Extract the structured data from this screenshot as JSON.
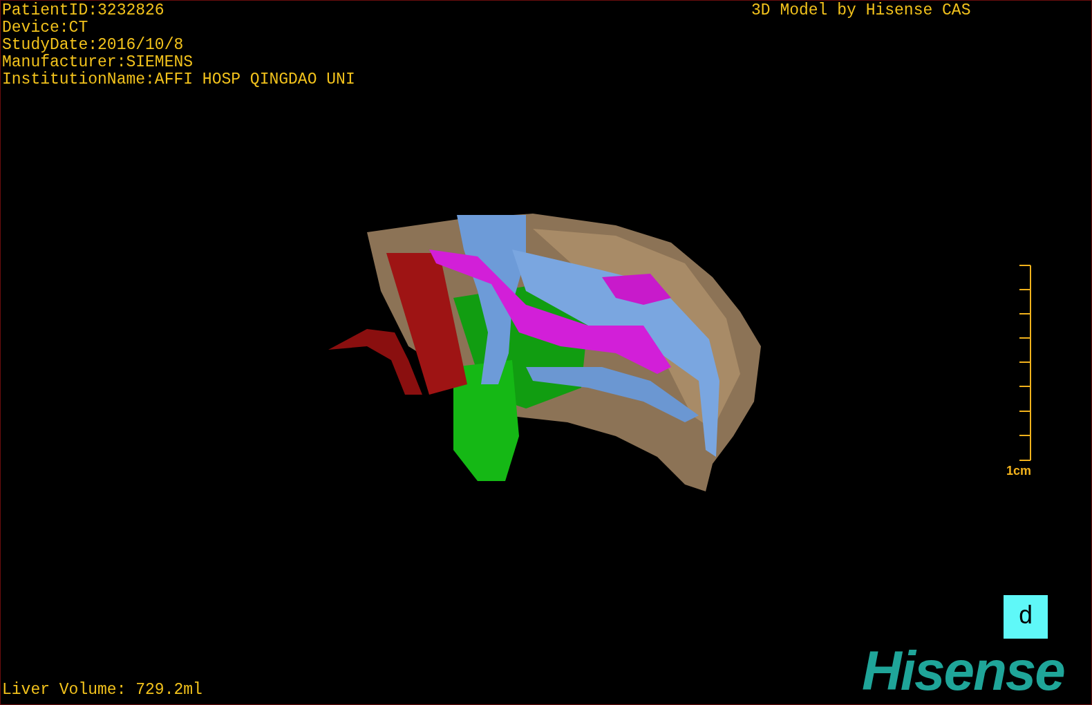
{
  "info_lines": [
    "PatientID:3232826",
    "Device:CT",
    "StudyDate:2016/10/8",
    "Manufacturer:SIEMENS",
    "InstitutionName:AFFI HOSP QINGDAO UNI"
  ],
  "title": "3D Model by Hisense CAS",
  "scale_bar": {
    "label": "1cm"
  },
  "orientation_marker": "d",
  "liver_volume": "Liver Volume: 729.2ml",
  "logo": "Hisense"
}
